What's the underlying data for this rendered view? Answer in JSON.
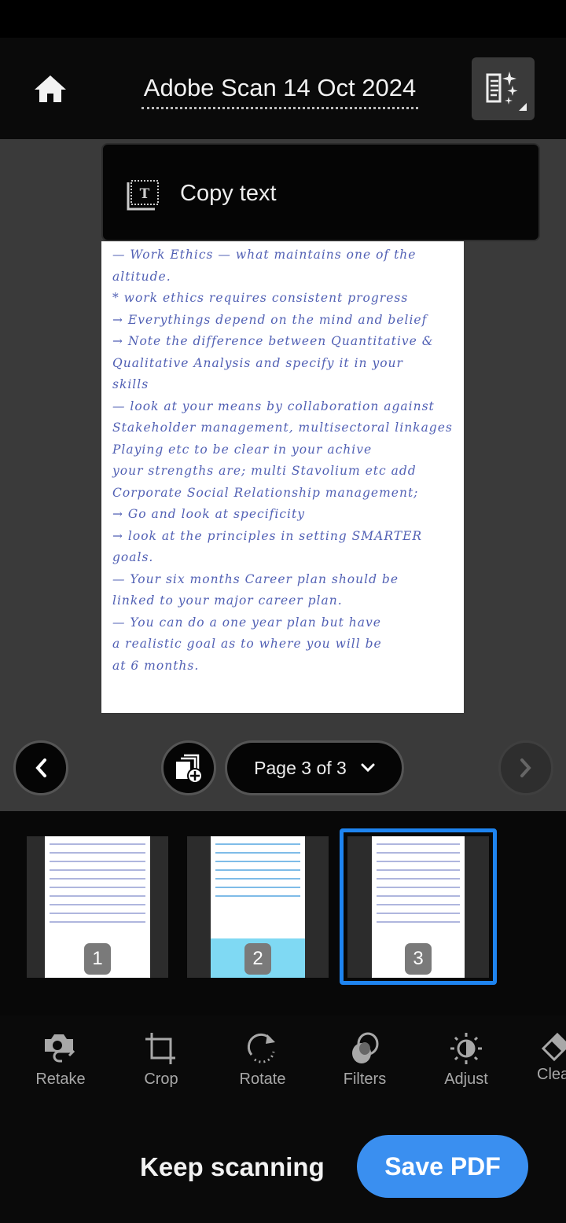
{
  "header": {
    "title": "Adobe Scan 14 Oct 2024"
  },
  "popup": {
    "copy_text": "Copy text"
  },
  "scan_lines": [
    "— Work Ethics — what maintains one of the",
    "altitude.",
    " * work ethics requires consistent progress",
    "→ Everythings depend on the mind and belief",
    "→ Note the difference between Quantitative &",
    "   Qualitative Analysis and specify it in your",
    "   skills",
    "— look at your means by collaboration against",
    "   Stakeholder management, multisectoral linkages",
    "   Playing etc  to be clear in your achive",
    "   your strengths are; multi Stavolium etc add",
    "   Corporate Social Relationship management;",
    "→ Go and look at specificity",
    "→ look at the principles in setting SMARTER",
    "   goals.",
    "— Your six months Career plan should be",
    "   linked to your major career plan.",
    "— You can do a one year plan but have",
    "   a realistic goal as to where you will be",
    "   at 6 months."
  ],
  "navigation": {
    "page_indicator": "Page 3 of 3"
  },
  "thumbnails": [
    {
      "label": "1"
    },
    {
      "label": "2"
    },
    {
      "label": "3",
      "selected": true
    }
  ],
  "tools": [
    {
      "label": "Retake",
      "icon": "retake-camera-icon"
    },
    {
      "label": "Crop",
      "icon": "crop-icon"
    },
    {
      "label": "Rotate",
      "icon": "rotate-icon"
    },
    {
      "label": "Filters",
      "icon": "filters-icon"
    },
    {
      "label": "Adjust",
      "icon": "adjust-brightness-icon"
    },
    {
      "label": "Clea",
      "icon": "cleanup-eraser-icon"
    }
  ],
  "actions": {
    "keep_scanning": "Keep scanning",
    "save_pdf": "Save PDF"
  },
  "colors": {
    "accent": "#3a8ff0",
    "selected_border": "#1e84f0",
    "viewer_bg": "#3a3a3a"
  }
}
